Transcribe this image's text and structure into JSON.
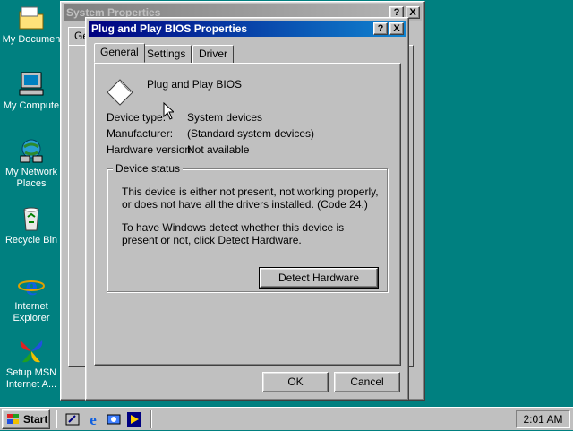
{
  "desktop": {
    "icons": [
      {
        "label": "My Documen",
        "icon": "folder-icon"
      },
      {
        "label": "My Compute",
        "icon": "computer-icon"
      },
      {
        "label": "My Network Places",
        "icon": "network-icon"
      },
      {
        "label": "Recycle Bin",
        "icon": "recycle-bin-icon"
      },
      {
        "label": "Internet Explorer",
        "icon": "ie-icon"
      },
      {
        "label": "Setup MSN Internet A...",
        "icon": "msn-icon"
      }
    ]
  },
  "system_properties": {
    "title": "System Properties",
    "visible_tab": "Gene",
    "help": "?",
    "close": "X"
  },
  "pnp_dialog": {
    "title": "Plug and Play BIOS Properties",
    "help": "?",
    "close": "X",
    "tabs": [
      "General",
      "Settings",
      "Driver"
    ],
    "selected_tab": "General",
    "device_name": "Plug and Play BIOS",
    "device_type_label": "Device type:",
    "device_type_value": "System devices",
    "manufacturer_label": "Manufacturer:",
    "manufacturer_value": "(Standard system devices)",
    "hardware_version_label": "Hardware version:",
    "hardware_version_value": "Not available",
    "device_status_title": "Device status",
    "status_text_1": "This device is either not present, not working properly, or does not have all the drivers installed.  (Code 24.)",
    "status_text_2": "To have Windows detect whether this device is present or not, click Detect Hardware.",
    "detect_button": "Detect Hardware",
    "ok_button": "OK",
    "cancel_button": "Cancel"
  },
  "taskbar": {
    "start_label": "Start",
    "clock": "2:01 AM",
    "quicklaunch": [
      "show-desktop-icon",
      "ie-icon",
      "channels-icon",
      "media-player-icon"
    ]
  }
}
